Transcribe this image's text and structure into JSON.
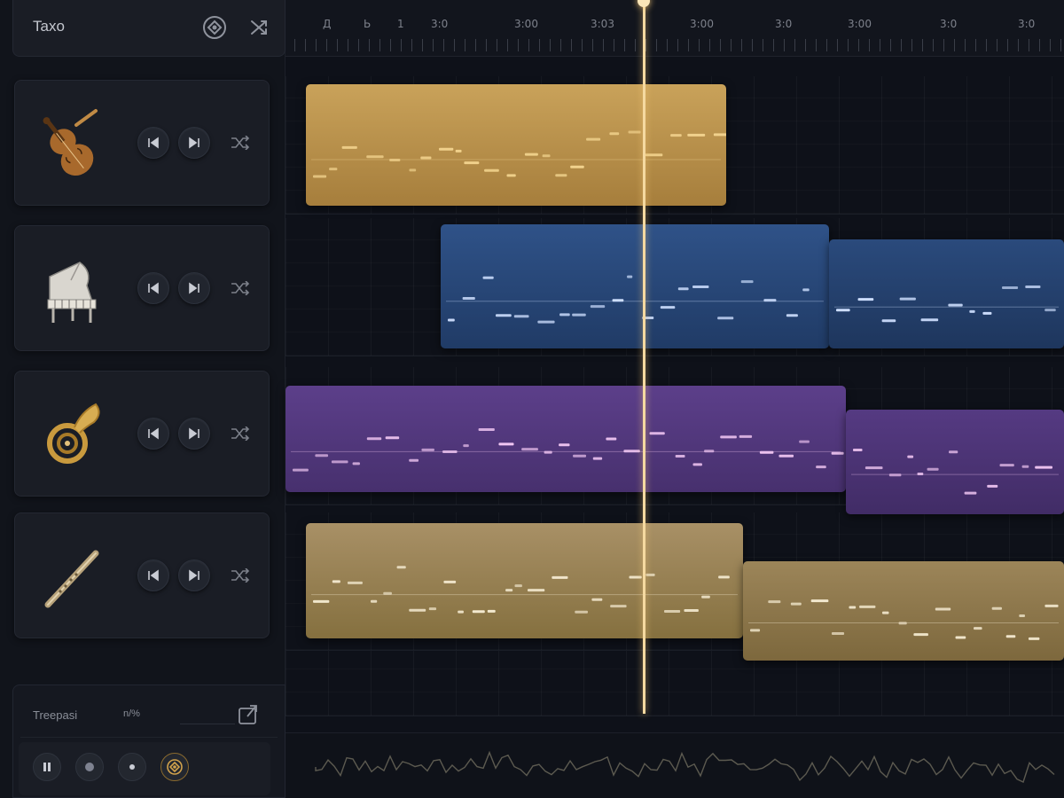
{
  "header": {
    "title": "Taxo",
    "icons": [
      "target-icon",
      "shuffle-icon"
    ]
  },
  "tracks": [
    {
      "name": "violin",
      "instrument_icon": "violin-icon",
      "color": "#c49a4e"
    },
    {
      "name": "piano",
      "instrument_icon": "piano-icon",
      "color": "#2b4c7e"
    },
    {
      "name": "horn",
      "instrument_icon": "horn-icon",
      "color": "#5a3c86"
    },
    {
      "name": "flute",
      "instrument_icon": "flute-icon",
      "color": "#a28b5c"
    }
  ],
  "track_controls": [
    "rewind-icon",
    "skip-icon",
    "shuffle-icon"
  ],
  "footer": {
    "label": "Treepasi",
    "value": "n/%",
    "export_icon": "export-icon",
    "transport_icons": [
      "pause-icon",
      "record-icon",
      "dot-icon",
      "target-icon"
    ]
  },
  "ruler": {
    "labels": [
      "Д",
      "Ь",
      "1",
      "3:0",
      "3:00",
      "3:03",
      "3:00",
      "3:0",
      "3:00",
      "3:0",
      "3:0"
    ]
  },
  "colors": {
    "accent": "#f5d9a0",
    "background": "#0d1017",
    "gold": "#c49a4e",
    "blue": "#2b4c7e",
    "purple": "#5a3c86",
    "tan": "#a28b5c"
  }
}
